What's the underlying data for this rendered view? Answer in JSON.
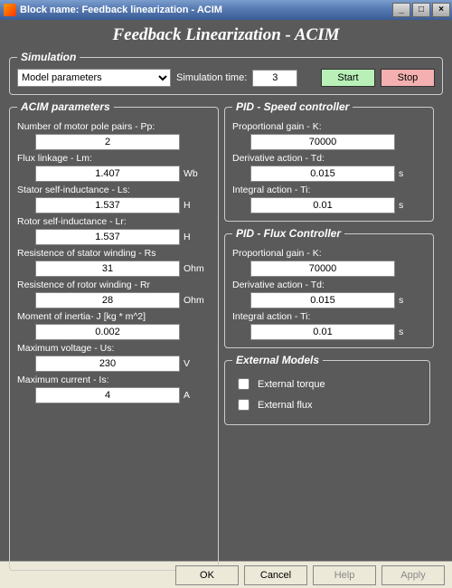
{
  "window": {
    "title": "Block name: Feedback linearization - ACIM",
    "main_title": "Feedback Linearization - ACIM"
  },
  "simulation": {
    "legend": "Simulation",
    "combo_value": "Model parameters",
    "time_label": "Simulation time:",
    "time_value": "3",
    "start_label": "Start",
    "stop_label": "Stop"
  },
  "acim": {
    "legend": "ACIM parameters",
    "params": [
      {
        "label": "Number of motor pole pairs - Pp:",
        "value": "2",
        "unit": ""
      },
      {
        "label": "Flux linkage - Lm:",
        "value": "1.407",
        "unit": "Wb"
      },
      {
        "label": "Stator self-inductance - Ls:",
        "value": "1.537",
        "unit": "H"
      },
      {
        "label": "Rotor self-inductance - Lr:",
        "value": "1.537",
        "unit": "H"
      },
      {
        "label": "Resistence of stator winding - Rs",
        "value": "31",
        "unit": "Ohm"
      },
      {
        "label": "Resistence of rotor winding - Rr",
        "value": "28",
        "unit": "Ohm"
      },
      {
        "label": "Moment of inertia- J [kg * m^2]",
        "value": "0.002",
        "unit": ""
      },
      {
        "label": "Maximum voltage - Us:",
        "value": "230",
        "unit": "V"
      },
      {
        "label": "Maximum current - Is:",
        "value": "4",
        "unit": "A"
      }
    ]
  },
  "pid_speed": {
    "legend": "PID - Speed controller",
    "params": [
      {
        "label": "Proportional gain - K:",
        "value": "70000",
        "unit": ""
      },
      {
        "label": "Derivative action - Td:",
        "value": "0.015",
        "unit": "s"
      },
      {
        "label": "Integral action - Ti:",
        "value": "0.01",
        "unit": "s"
      }
    ]
  },
  "pid_flux": {
    "legend": "PID - Flux Controller",
    "params": [
      {
        "label": "Proportional gain - K:",
        "value": "70000",
        "unit": ""
      },
      {
        "label": "Derivative action - Td:",
        "value": "0.015",
        "unit": "s"
      },
      {
        "label": "Integral action - Ti:",
        "value": "0.01",
        "unit": "s"
      }
    ]
  },
  "external": {
    "legend": "External Models",
    "torque_label": "External torque",
    "flux_label": "External flux"
  },
  "buttons": {
    "ok": "OK",
    "cancel": "Cancel",
    "help": "Help",
    "apply": "Apply"
  }
}
